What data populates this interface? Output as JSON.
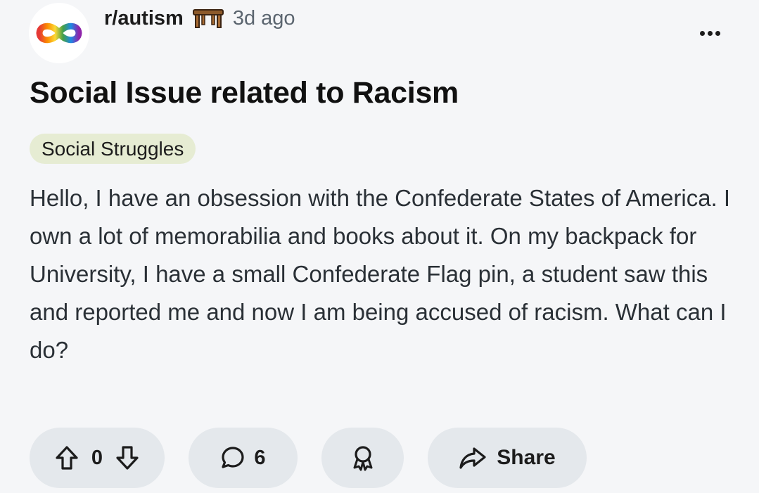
{
  "header": {
    "subreddit": "r/autism",
    "time": "3d ago",
    "avatar_icon": "infinity-rainbow-icon",
    "flair_icon": "bench-icon",
    "more_icon": "more-options-icon"
  },
  "post": {
    "title": "Social Issue related to Racism",
    "flair": "Social Struggles",
    "body": "Hello, I have an obsession with the Confederate States of America. I own a lot of memorabilia and books about it. On my backpack for University, I have a small Confederate Flag pin, a student saw this and reported me and now I am being accused of racism. What can I do?"
  },
  "actions": {
    "vote_count": "0",
    "comment_count": "6",
    "share_label": "Share"
  },
  "colors": {
    "background": "#f5f6f8",
    "pill": "#e4e8ec",
    "flair_bg": "#e6ecd3",
    "text": "#1c1c1c",
    "muted": "#5c6670"
  }
}
